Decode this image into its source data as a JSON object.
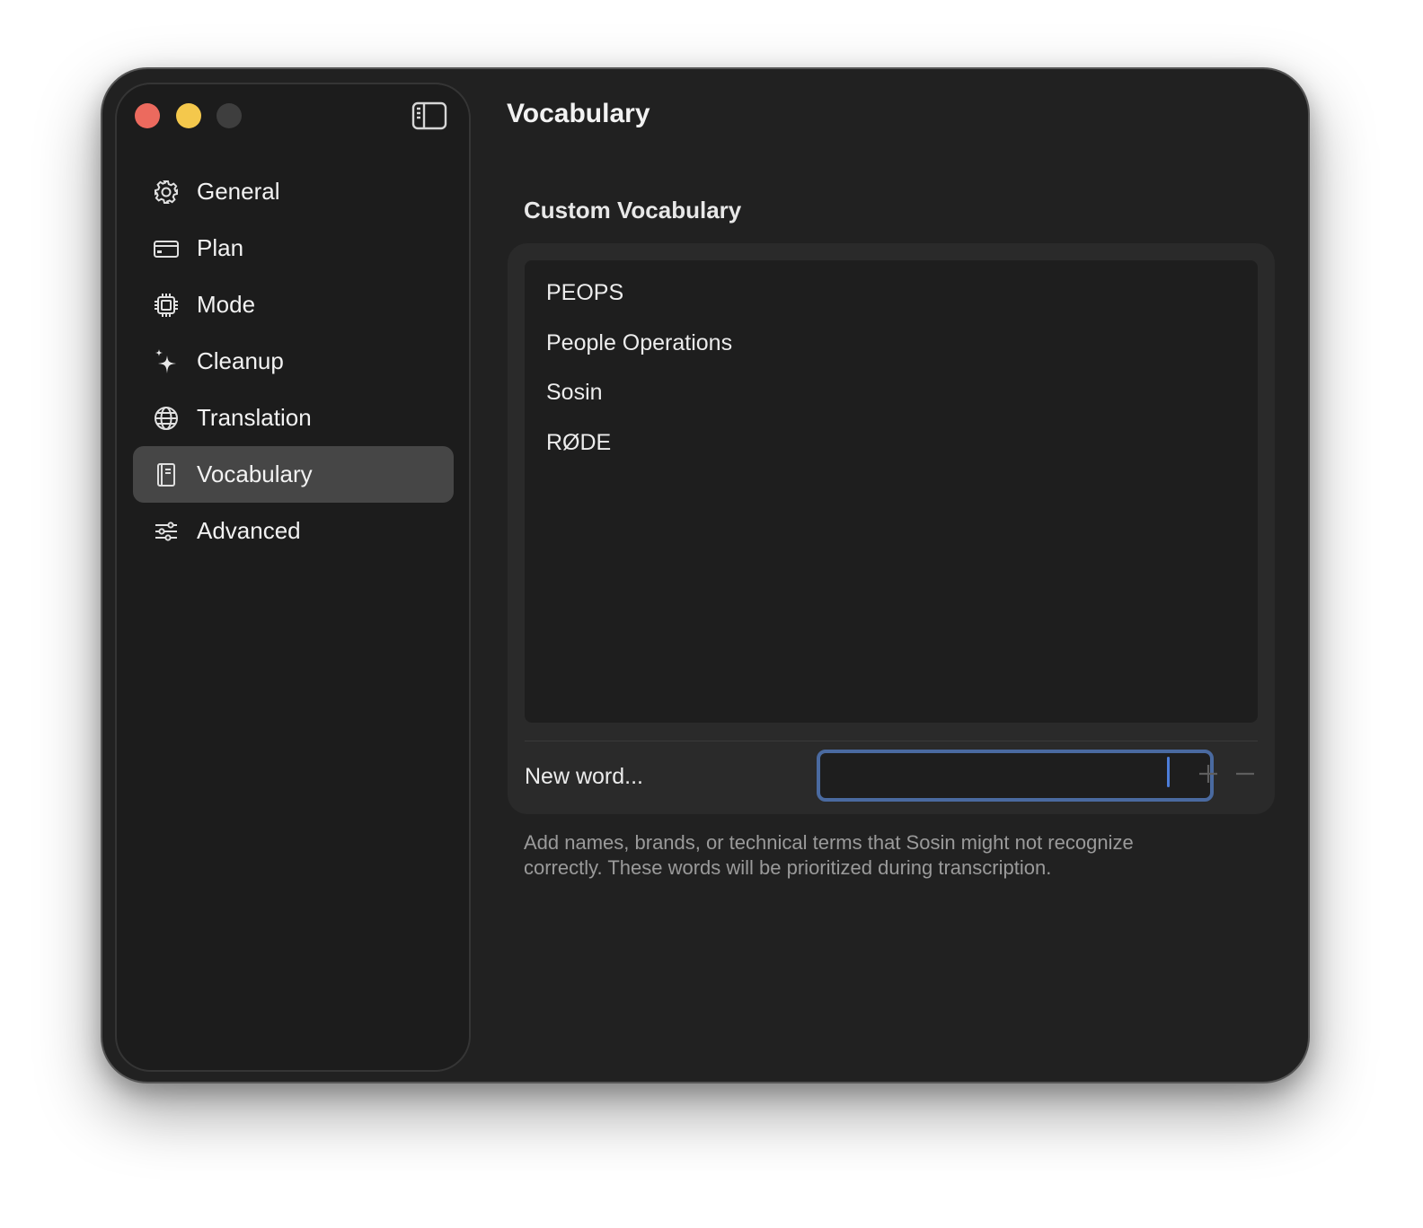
{
  "window": {
    "title": "Vocabulary"
  },
  "sidebar": {
    "items": [
      {
        "label": "General",
        "icon": "gear-icon"
      },
      {
        "label": "Plan",
        "icon": "credit-card-icon"
      },
      {
        "label": "Mode",
        "icon": "cpu-chip-icon"
      },
      {
        "label": "Cleanup",
        "icon": "sparkles-icon"
      },
      {
        "label": "Translation",
        "icon": "globe-icon"
      },
      {
        "label": "Vocabulary",
        "icon": "book-icon",
        "active": true
      },
      {
        "label": "Advanced",
        "icon": "sliders-icon"
      }
    ]
  },
  "main": {
    "section_title": "Custom Vocabulary",
    "words": [
      "PEOPS",
      "People Operations",
      "Sosin",
      "RØDE"
    ],
    "new_word_label": "New word...",
    "new_word_value": "",
    "helper_text": "Add names, brands, or technical terms that Sosin might not recognize correctly. These words will be prioritized during transcription."
  },
  "colors": {
    "window_bg": "#212121",
    "sidebar_bg": "#1c1c1c",
    "active_item_bg": "#464646",
    "focus_ring": "#4a6aa0",
    "traffic_close": "#ec6a5e",
    "traffic_minimize": "#f4c84c",
    "traffic_zoom_disabled": "#3e3e3e"
  }
}
